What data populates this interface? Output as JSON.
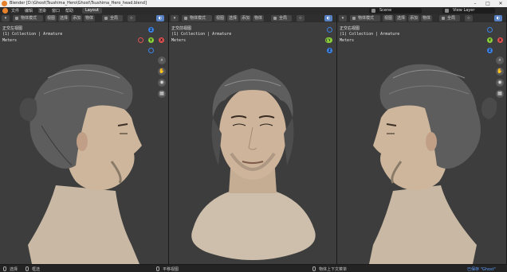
{
  "window": {
    "title": "Blender [D:\\Ghost\\Tsushima_Hero\\Ghost\\Tsushima_Hero_head.blend]",
    "controls": [
      "–",
      "□",
      "✕"
    ]
  },
  "menubar": {
    "items": [
      "文件",
      "编辑",
      "渲染",
      "窗口",
      "帮助"
    ],
    "workspace_tab": "Layout",
    "scene_label": "Scene",
    "view_layer_label": "View Layer"
  },
  "viewport_header": {
    "mode": "物体模式",
    "view": "视图",
    "select": "选择",
    "add": "添加",
    "object": "物体",
    "transform": "全局"
  },
  "viewports": [
    {
      "view_name": "正交左视图",
      "collection": "(1) Collection | Armature",
      "units": "Meters"
    },
    {
      "view_name": "正交前视图",
      "collection": "(1) Collection | Armature",
      "units": "Meters"
    },
    {
      "view_name": "正交右视图",
      "collection": "(1) Collection | Armature",
      "units": "Meters"
    }
  ],
  "gizmo": {
    "x": "X",
    "y": "Y",
    "z": "Z"
  },
  "statusbar": {
    "select": "选择",
    "box_select": "框选",
    "pan_view": "平移视图",
    "context_menu": "物体上下文菜单",
    "message": "已保存 \"Ghost\""
  },
  "colors": {
    "viewport_bg": "#3d3d3d",
    "header_bg": "#2e2e2e",
    "accent": "#5680c2",
    "blender_orange": "#e8812c"
  },
  "icons": [
    "blender-logo-icon",
    "zoom-icon",
    "hand-pan-icon",
    "camera-icon",
    "grid-icon",
    "mouse-icon"
  ]
}
